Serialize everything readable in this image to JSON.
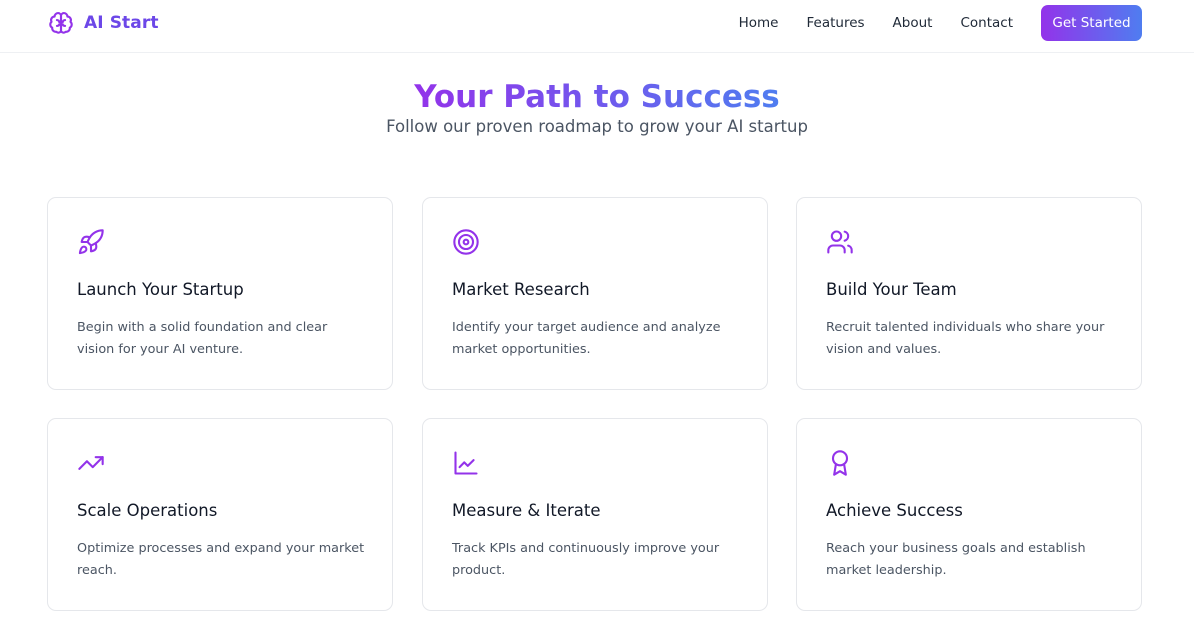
{
  "brand": {
    "name": "AI Start",
    "icon": "brain-icon"
  },
  "nav": {
    "links": [
      "Home",
      "Features",
      "About",
      "Contact"
    ],
    "cta": "Get Started"
  },
  "hero": {
    "title": "Your Path to Success",
    "subtitle": "Follow our proven roadmap to grow your AI startup"
  },
  "cards": [
    {
      "icon": "rocket-icon",
      "title": "Launch Your Startup",
      "description": "Begin with a solid foundation and clear vision for your AI venture."
    },
    {
      "icon": "target-icon",
      "title": "Market Research",
      "description": "Identify your target audience and analyze market opportunities."
    },
    {
      "icon": "users-icon",
      "title": "Build Your Team",
      "description": "Recruit talented individuals who share your vision and values."
    },
    {
      "icon": "trending-up-icon",
      "title": "Scale Operations",
      "description": "Optimize processes and expand your market reach."
    },
    {
      "icon": "line-chart-icon",
      "title": "Measure & Iterate",
      "description": "Track KPIs and continuously improve your product."
    },
    {
      "icon": "award-icon",
      "title": "Achieve Success",
      "description": "Reach your business goals and establish market leadership."
    }
  ],
  "colors": {
    "accent": "#9333ea",
    "gradient_start": "#9333ea",
    "gradient_end": "#4f7df0",
    "brand_text": "#6c47e8"
  }
}
